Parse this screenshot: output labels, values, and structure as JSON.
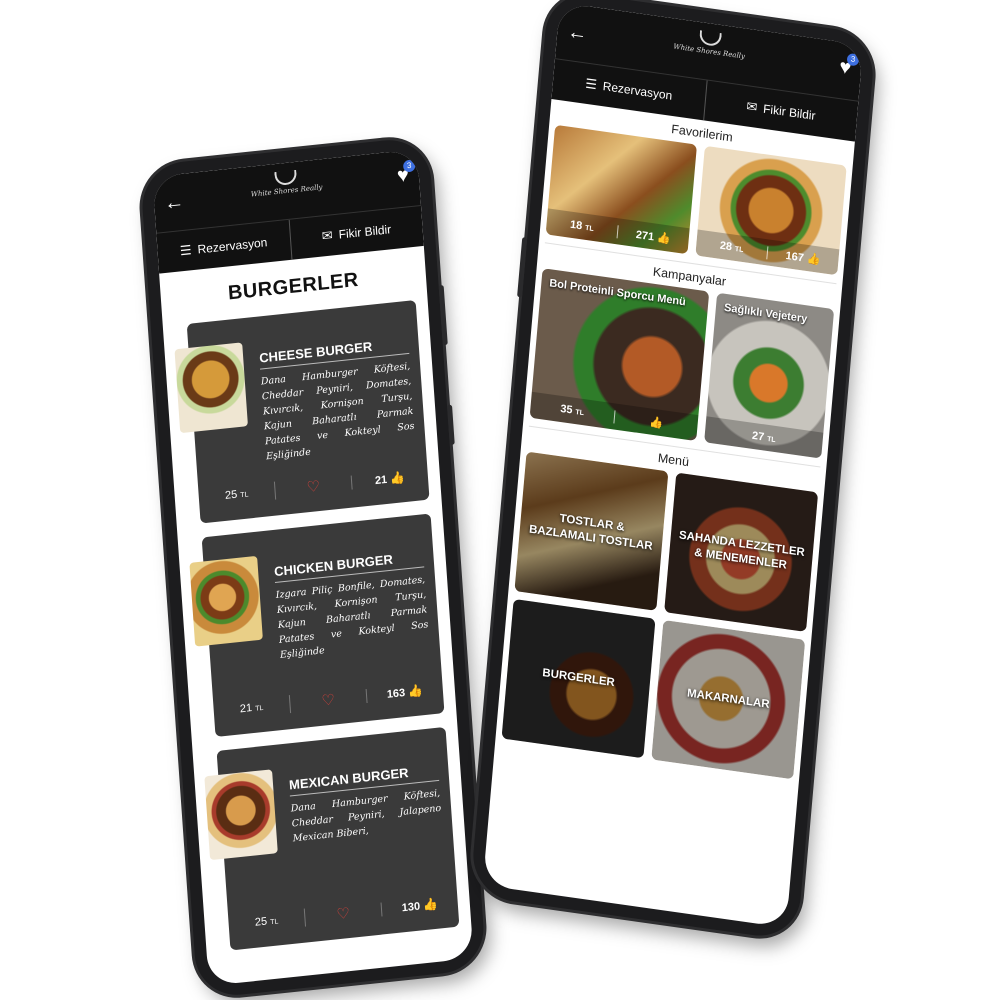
{
  "app": {
    "logo_text": "White Shores Really",
    "back_icon": "arrow-left-icon",
    "favorites_badge": "3",
    "actions": {
      "reservation": "Rezervasyon",
      "feedback": "Fikir Bildir"
    }
  },
  "left_screen": {
    "title": "BURGERLER",
    "currency": "TL",
    "products": [
      {
        "name": "CHEESE BURGER",
        "description": "Dana Hamburger Köftesi, Cheddar Peyniri, Domates, Kıvırcık, Kornişon Turşu, Kajun Baharatlı Parmak Patates ve Kokteyl Sos Eşliğinde",
        "price": "25",
        "likes": "21"
      },
      {
        "name": "CHICKEN BURGER",
        "description": "Izgara Piliç Bonfile, Domates, Kıvırcık, Kornişon Turşu, Kajun Baharatlı Parmak Patates ve Kokteyl Sos Eşliğinde",
        "price": "21",
        "likes": "163"
      },
      {
        "name": "MEXICAN BURGER",
        "description": "Dana Hamburger Köftesi, Cheddar Peyniri, Jalapeno Mexican Biberi,",
        "price": "25",
        "likes": "130"
      }
    ]
  },
  "right_screen": {
    "favorites": {
      "title": "Favorilerim",
      "items": [
        {
          "price": "18",
          "likes": "271"
        },
        {
          "price": "28",
          "likes": "167"
        }
      ]
    },
    "campaigns": {
      "title": "Kampanyalar",
      "items": [
        {
          "name": "Bol Proteinli Sporcu Menü",
          "price": "35",
          "likes": ""
        },
        {
          "name": "Sağlıklı Vejetery",
          "price": "27",
          "likes": ""
        }
      ]
    },
    "menu": {
      "title": "Menü",
      "categories": [
        "TOSTLAR & BAZLAMALI TOSTLAR",
        "SAHANDA LEZZETLER & MENEMENLER",
        "BURGERLER",
        "MAKARNALAR"
      ]
    },
    "currency": "TL"
  },
  "colors": {
    "header_bg": "#111111",
    "card_bg": "#3a3a3a",
    "heart": "#d9413a",
    "badge": "#3d6fe0"
  }
}
